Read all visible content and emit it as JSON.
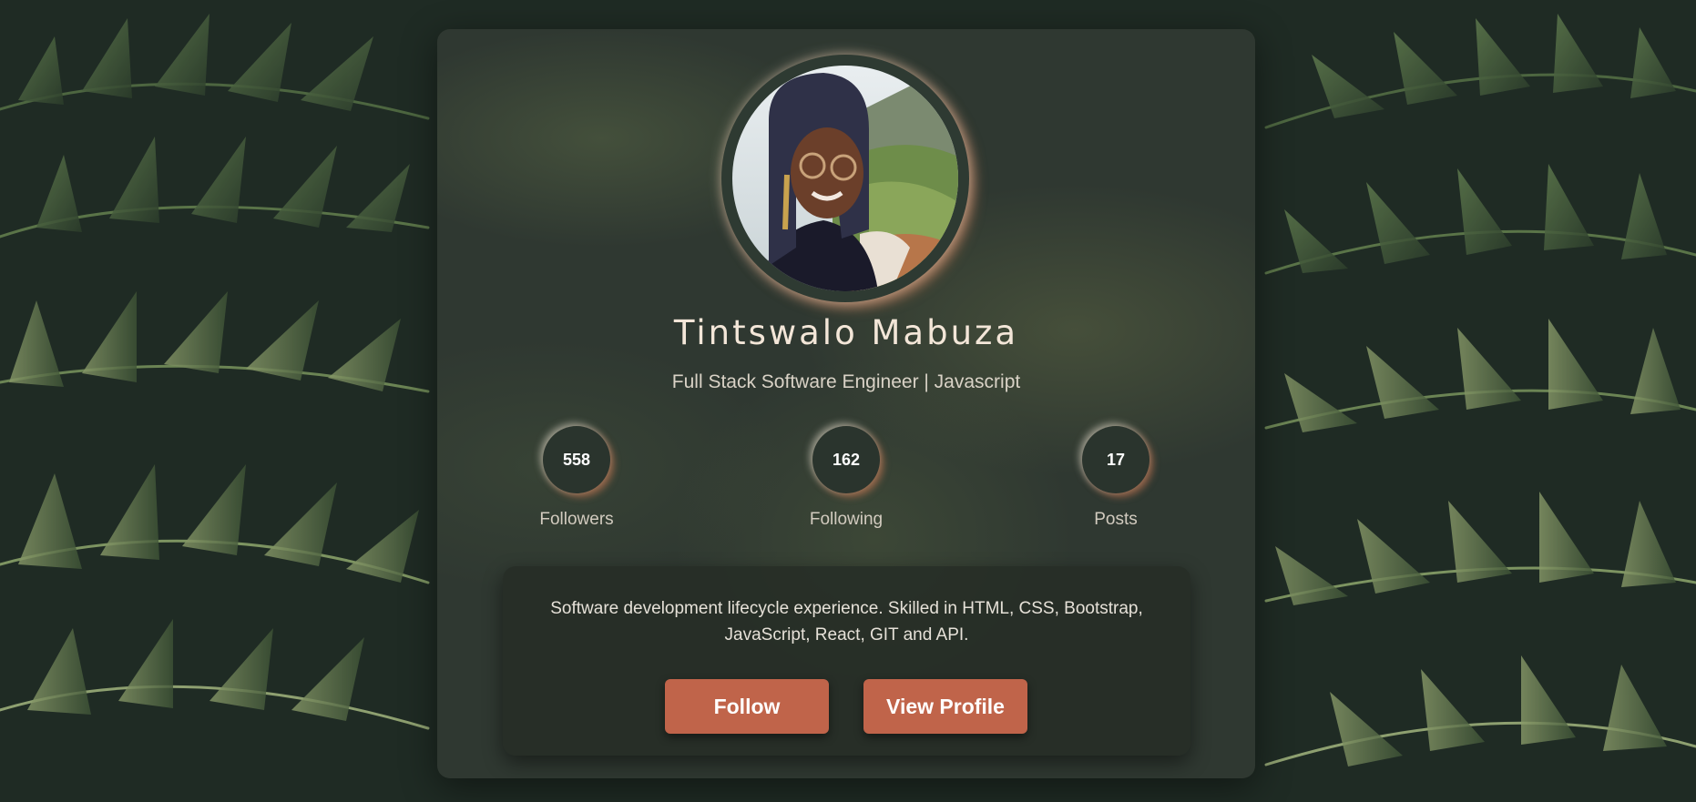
{
  "profile": {
    "name": "Tintswalo Mabuza",
    "title": "Full Stack Software Engineer | Javascript",
    "avatar_alt": "profile-photo"
  },
  "stats": [
    {
      "value": "558",
      "label": "Followers"
    },
    {
      "value": "162",
      "label": "Following"
    },
    {
      "value": "17",
      "label": "Posts"
    }
  ],
  "bio": "Software development lifecycle experience. Skilled in HTML, CSS, Bootstrap, JavaScript, React, GIT and API.",
  "actions": {
    "follow_label": "Follow",
    "view_profile_label": "View Profile"
  },
  "colors": {
    "accent": "#c0644a",
    "card": "#343c34",
    "text_light": "#f3e6d8"
  }
}
